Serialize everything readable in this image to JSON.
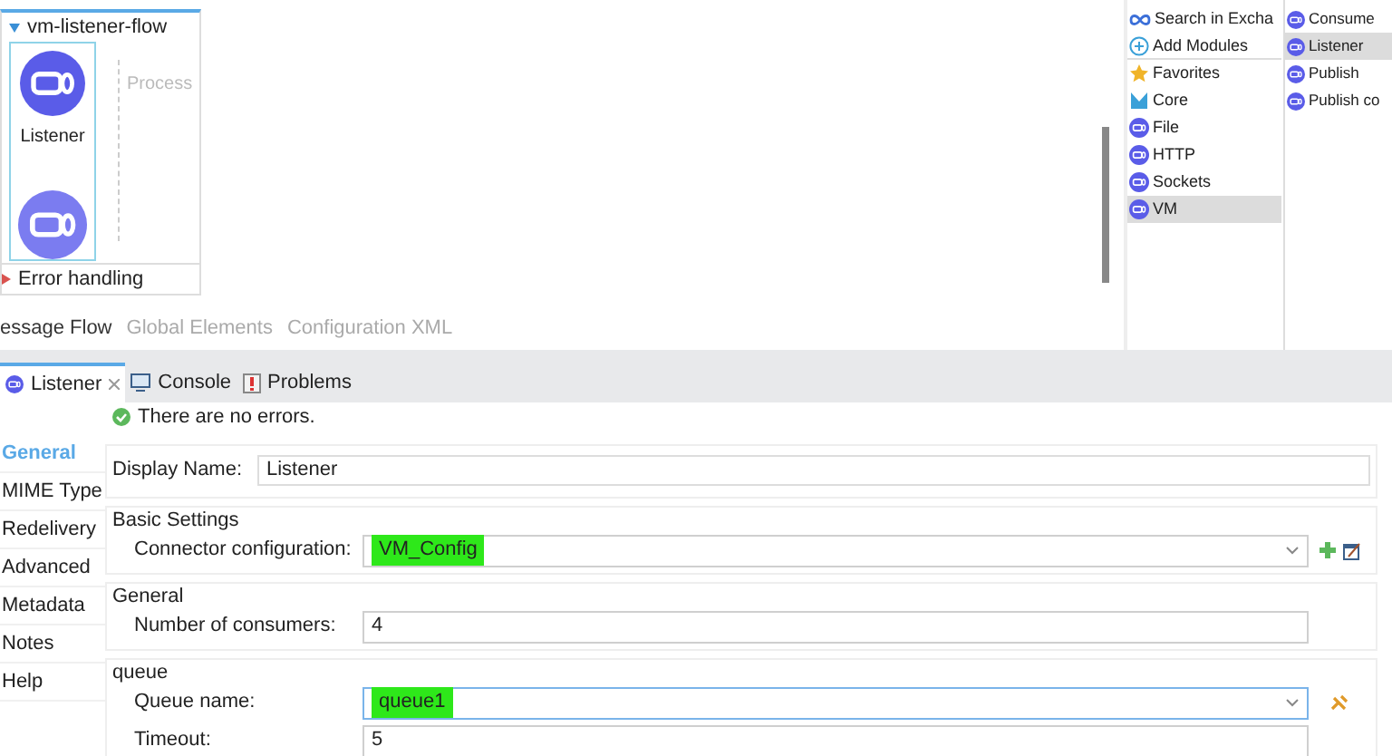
{
  "flow": {
    "name": "vm-listener-flow",
    "expanded": true,
    "source_label": "Listener",
    "process_label": "Process",
    "error_handling": "Error handling"
  },
  "editor_tabs": [
    {
      "label": "essage Flow",
      "selected": true
    },
    {
      "label": "Global Elements",
      "selected": false
    },
    {
      "label": "Configuration XML",
      "selected": false
    }
  ],
  "palette": {
    "categories": [
      {
        "label": "Search in Excha",
        "kind": "exchange",
        "selected": false
      },
      {
        "label": "Add Modules",
        "kind": "add",
        "selected": false
      },
      {
        "label": "Favorites",
        "kind": "star",
        "selected": false
      },
      {
        "label": "Core",
        "kind": "core",
        "selected": false
      },
      {
        "label": "File",
        "kind": "module",
        "selected": false
      },
      {
        "label": "HTTP",
        "kind": "module",
        "selected": false
      },
      {
        "label": "Sockets",
        "kind": "module",
        "selected": false
      },
      {
        "label": "VM",
        "kind": "module",
        "selected": true
      }
    ],
    "operations": [
      {
        "label": "Consume",
        "selected": false
      },
      {
        "label": "Listener",
        "selected": true
      },
      {
        "label": "Publish",
        "selected": false
      },
      {
        "label": "Publish co",
        "selected": false
      }
    ]
  },
  "bottom_tabs": [
    {
      "label": "Listener",
      "selected": true,
      "closable": true,
      "kind": "component"
    },
    {
      "label": "Console",
      "selected": false,
      "closable": false,
      "kind": "console"
    },
    {
      "label": "Problems",
      "selected": false,
      "closable": false,
      "kind": "problems"
    }
  ],
  "status": "There are no errors.",
  "nav": [
    {
      "label": "General",
      "selected": true
    },
    {
      "label": "MIME Type",
      "selected": false
    },
    {
      "label": "Redelivery",
      "selected": false
    },
    {
      "label": "Advanced",
      "selected": false
    },
    {
      "label": "Metadata",
      "selected": false
    },
    {
      "label": "Notes",
      "selected": false
    },
    {
      "label": "Help",
      "selected": false
    }
  ],
  "form": {
    "display_name": {
      "label": "Display Name:",
      "value": "Listener"
    },
    "groups": [
      {
        "title": "Basic Settings",
        "fields": [
          {
            "label": "Connector configuration:",
            "value": "VM_Config",
            "kind": "dropdown",
            "highlighted": true,
            "focused": false,
            "add_button": true,
            "edit_button": true
          }
        ]
      },
      {
        "title": "General",
        "fields": [
          {
            "label": "Number of consumers:",
            "value": "4",
            "kind": "text",
            "highlighted": false,
            "focused": false
          }
        ]
      },
      {
        "title": "queue",
        "fields": [
          {
            "label": "Queue name:",
            "value": "queue1",
            "kind": "dropdown",
            "highlighted": true,
            "focused": true,
            "expression_button": true
          },
          {
            "label": "Timeout:",
            "value": "5",
            "kind": "text",
            "highlighted": false,
            "focused": false
          }
        ]
      }
    ]
  }
}
